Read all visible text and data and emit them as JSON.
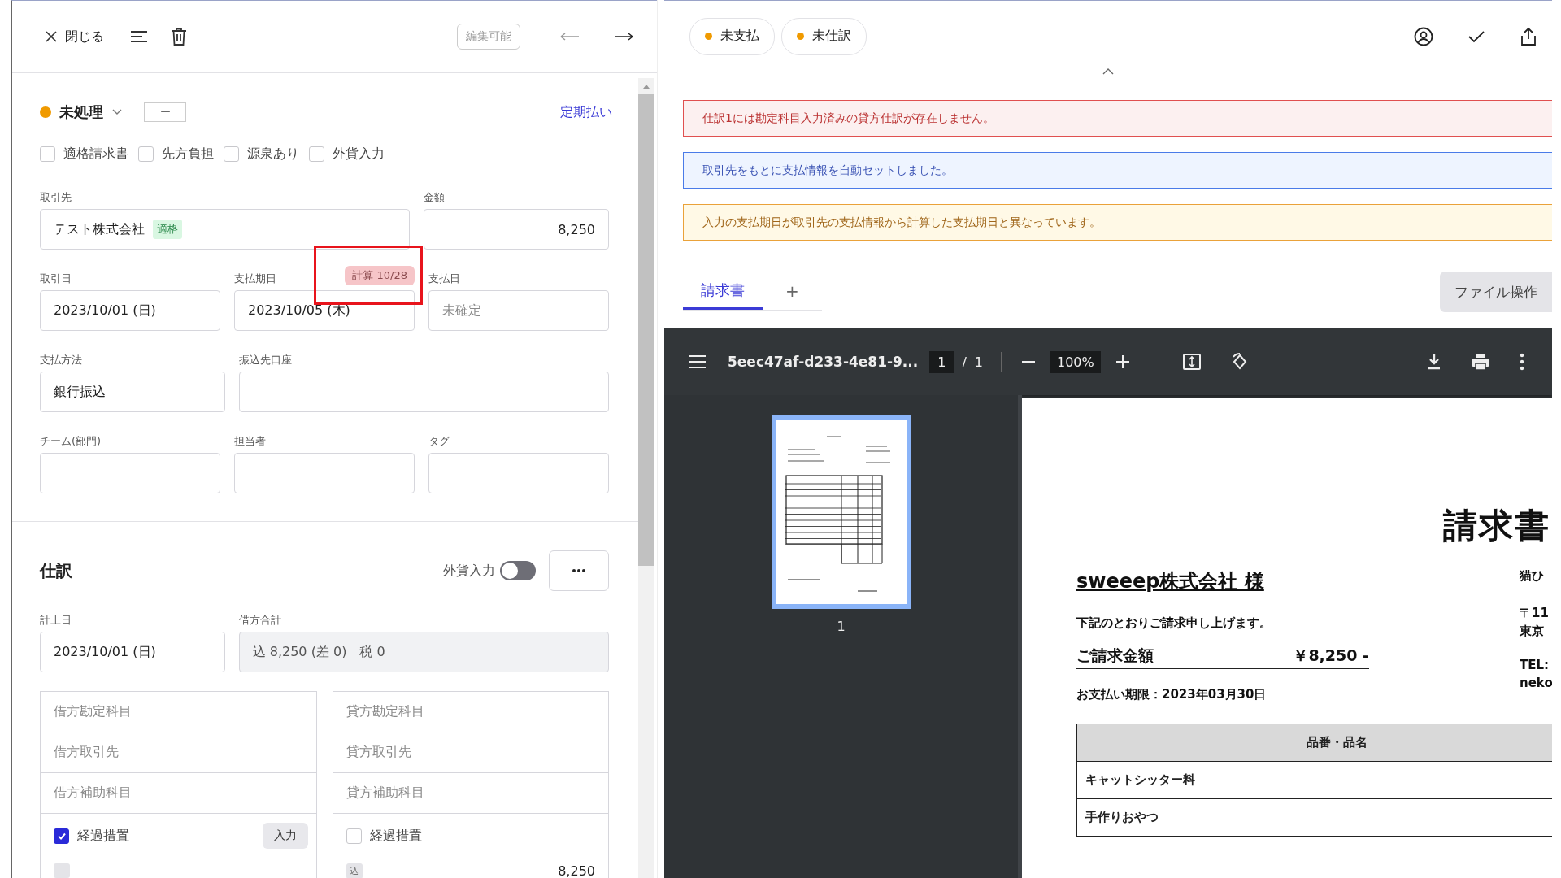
{
  "toolbar": {
    "close": "閉じる",
    "edit_mode": "編集可能",
    "nav": [
      {
        "kind": "prev",
        "disabled": true
      },
      {
        "kind": "next",
        "disabled": false
      }
    ]
  },
  "status": {
    "label": "未処理",
    "color": "#f09a00",
    "code": "ー",
    "recurring_link": "定期払い"
  },
  "flags": [
    {
      "label": "適格請求書",
      "checked": false
    },
    {
      "label": "先方負担",
      "checked": false
    },
    {
      "label": "源泉あり",
      "checked": false
    },
    {
      "label": "外貨入力",
      "checked": false
    }
  ],
  "field_rows": [
    [
      {
        "kind": "text",
        "label": "取引先",
        "value": "テスト株式会社",
        "badge": "適格"
      },
      {
        "kind": "amount",
        "label": "金額",
        "value": "8,250"
      }
    ],
    [
      {
        "kind": "text",
        "label": "取引日",
        "value": "2023/10/01 (日)"
      },
      {
        "kind": "text",
        "label": "支払期日",
        "value": "2023/10/05 (木)",
        "calc_badge": "計算 10/28"
      },
      {
        "kind": "text",
        "label": "支払日",
        "placeholder": "未確定"
      }
    ],
    [
      {
        "kind": "text",
        "label": "支払方法",
        "value": "銀行振込"
      },
      {
        "kind": "text",
        "label": "振込先口座"
      }
    ],
    [
      {
        "kind": "text",
        "label": "チーム(部門)"
      },
      {
        "kind": "text",
        "label": "担当者"
      },
      {
        "kind": "text",
        "label": "タグ"
      }
    ]
  ],
  "journal": {
    "title": "仕訳",
    "foreign_currency": {
      "label": "外貨入力",
      "on": false
    },
    "date": {
      "label": "計上日",
      "value": "2023/10/01 (日)"
    },
    "debit_total": {
      "label": "借方合計",
      "value": "込 8,250 (差 0)　税 0",
      "disabled": true
    },
    "debit": {
      "placeholders": [
        "借方勘定科目",
        "借方取引先",
        "借方補助科目"
      ],
      "transitional": {
        "label": "経過措置",
        "checked": true,
        "button": "入力"
      }
    },
    "credit": {
      "placeholders": [
        "貸方勘定科目",
        "貸方取引先",
        "貸方補助科目"
      ],
      "transitional": {
        "label": "経過措置",
        "checked": false
      },
      "tax_badge": "込",
      "amount": "8,250"
    }
  },
  "chips": [
    {
      "label": "未支払",
      "color": "#f09a00"
    },
    {
      "label": "未仕訳",
      "color": "#f09a00"
    }
  ],
  "alerts": [
    {
      "kind": "error",
      "text": "仕訳1には勘定科目入力済みの貸方仕訳が存在しません。"
    },
    {
      "kind": "info",
      "text": "取引先をもとに支払情報を自動セットしました。"
    },
    {
      "kind": "warning",
      "text": "入力の支払期日が取引先の支払情報から計算した支払期日と異なっています。"
    }
  ],
  "doc_tabs": [
    {
      "label": "請求書",
      "selected": true
    }
  ],
  "add_tab": "+",
  "file_button": "ファイル操作",
  "viewer": {
    "filename": "5eec47af-d233-4e81-9...",
    "page": "1",
    "page_separator": "/",
    "page_count": "1",
    "zoom": "100%",
    "thumbnails": [
      {
        "label": "1",
        "selected": true
      }
    ],
    "document": {
      "title": "請求書",
      "recipient": "sweeep株式会社 様",
      "greeting": "下記のとおりご請求申し上げます。",
      "amount_label": "ご請求金額",
      "amount": "￥8,250 -",
      "due": "お支払い期限：2023年03月30日",
      "issuer_lines": [
        "猫ひ",
        "〒11",
        "東京",
        "TEL:",
        "neko"
      ],
      "table": {
        "columns": [
          "品番・品名"
        ],
        "rows": [
          [
            "キャットシッター料"
          ],
          [
            "手作りおやつ"
          ]
        ]
      }
    }
  }
}
